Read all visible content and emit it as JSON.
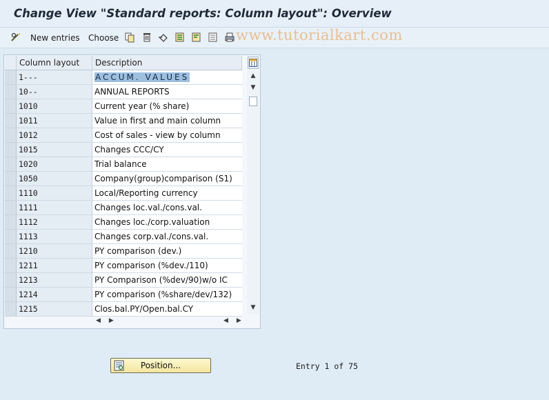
{
  "window": {
    "title": "Change View \"Standard reports: Column layout\": Overview"
  },
  "toolbar": {
    "new_entries_label": "New entries",
    "choose_label": "Choose",
    "icons": [
      "edit-glasses-icon",
      "copy-icon",
      "delete-icon",
      "undo-icon",
      "select-all-icon",
      "select-block-icon",
      "deselect-icon",
      "print-icon"
    ]
  },
  "watermark": {
    "text": "www.tutorialkart.com"
  },
  "table": {
    "columns": [
      "Column layout",
      "Description"
    ],
    "rows": [
      {
        "layout": "1---",
        "description": "ACCUM. VALUES",
        "selected": true
      },
      {
        "layout": "10--",
        "description": "ANNUAL REPORTS"
      },
      {
        "layout": "1010",
        "description": "Current year (% share)"
      },
      {
        "layout": "1011",
        "description": "Value in first and main column"
      },
      {
        "layout": "1012",
        "description": "Cost of sales - view by column"
      },
      {
        "layout": "1015",
        "description": "Changes CCC/CY"
      },
      {
        "layout": "1020",
        "description": "Trial balance"
      },
      {
        "layout": "1050",
        "description": "Company(group)comparison  (S1)"
      },
      {
        "layout": "1110",
        "description": "Local/Reporting currency"
      },
      {
        "layout": "1111",
        "description": "Changes loc.val./cons.val."
      },
      {
        "layout": "1112",
        "description": "Changes loc./corp.valuation"
      },
      {
        "layout": "1113",
        "description": "Changes corp.val./cons.val."
      },
      {
        "layout": "1210",
        "description": "PY comparison (dev.)"
      },
      {
        "layout": "1211",
        "description": "PY comparison (%dev./110)"
      },
      {
        "layout": "1213",
        "description": "PY Comparison (%dev/90)w/o IC"
      },
      {
        "layout": "1214",
        "description": "PY comparison (%share/dev/132)"
      },
      {
        "layout": "1215",
        "description": "Clos.bal.PY/Open.bal.CY"
      }
    ]
  },
  "footer": {
    "position_button_label": "Position...",
    "entry_text": "Entry 1 of 75"
  },
  "colors": {
    "background": "#dfebf5",
    "selection": "#9fbfdf",
    "button": "#f4e6a0"
  }
}
